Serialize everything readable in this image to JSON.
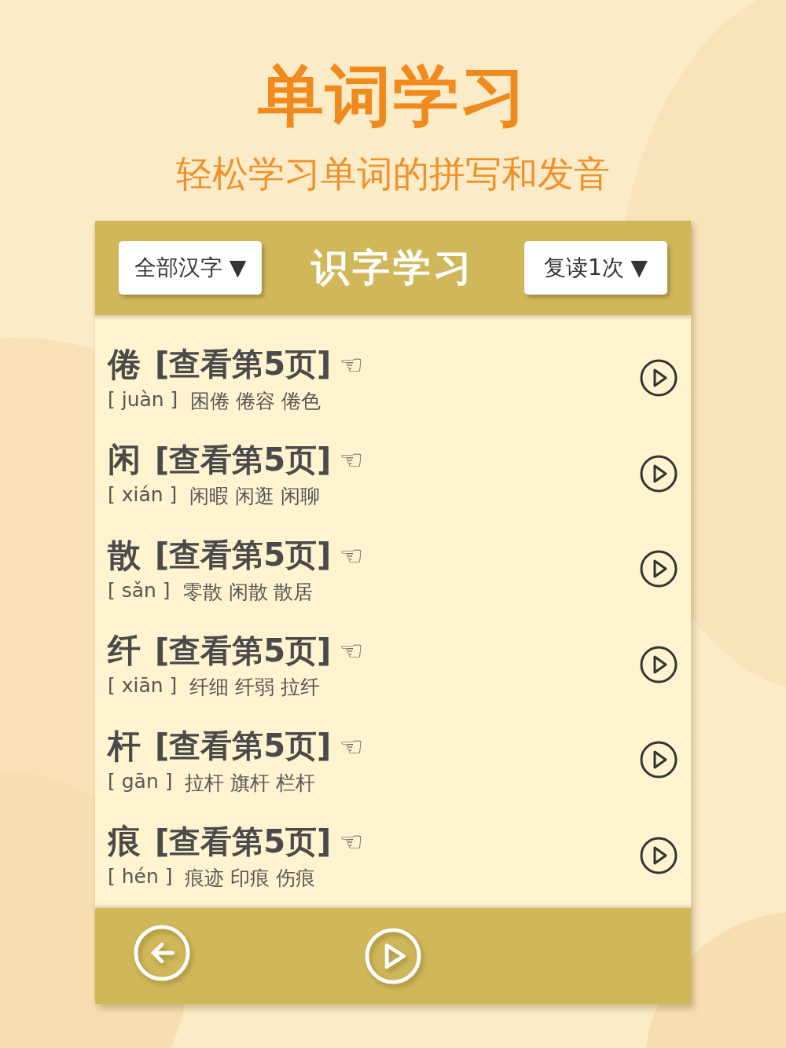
{
  "title": "单词学习",
  "subtitle": "轻松学习单词的拼写和发音",
  "header": {
    "left_dropdown": {
      "label": "全部汉字",
      "caret": "▼"
    },
    "title": "识字学习",
    "right_dropdown": {
      "label": "复读1次",
      "caret": "▼"
    }
  },
  "words": [
    {
      "char": "倦",
      "page_link": "[查看第5页]",
      "pointer": "☜",
      "pinyin": "[ juàn ]",
      "examples": "困倦 倦容 倦色"
    },
    {
      "char": "闲",
      "page_link": "[查看第5页]",
      "pointer": "☜",
      "pinyin": "[ xián ]",
      "examples": "闲暇 闲逛 闲聊"
    },
    {
      "char": "散",
      "page_link": "[查看第5页]",
      "pointer": "☜",
      "pinyin": "[ sǎn ]",
      "examples": "零散 闲散 散居"
    },
    {
      "char": "纤",
      "page_link": "[查看第5页]",
      "pointer": "☜",
      "pinyin": "[ xiān ]",
      "examples": "纤细 纤弱 拉纤"
    },
    {
      "char": "杆",
      "page_link": "[查看第5页]",
      "pointer": "☜",
      "pinyin": "[ gān ]",
      "examples": "拉杆 旗杆 栏杆"
    },
    {
      "char": "痕",
      "page_link": "[查看第5页]",
      "pointer": "☜",
      "pinyin": "[ hén ]",
      "examples": "痕迹 印痕 伤痕"
    }
  ]
}
